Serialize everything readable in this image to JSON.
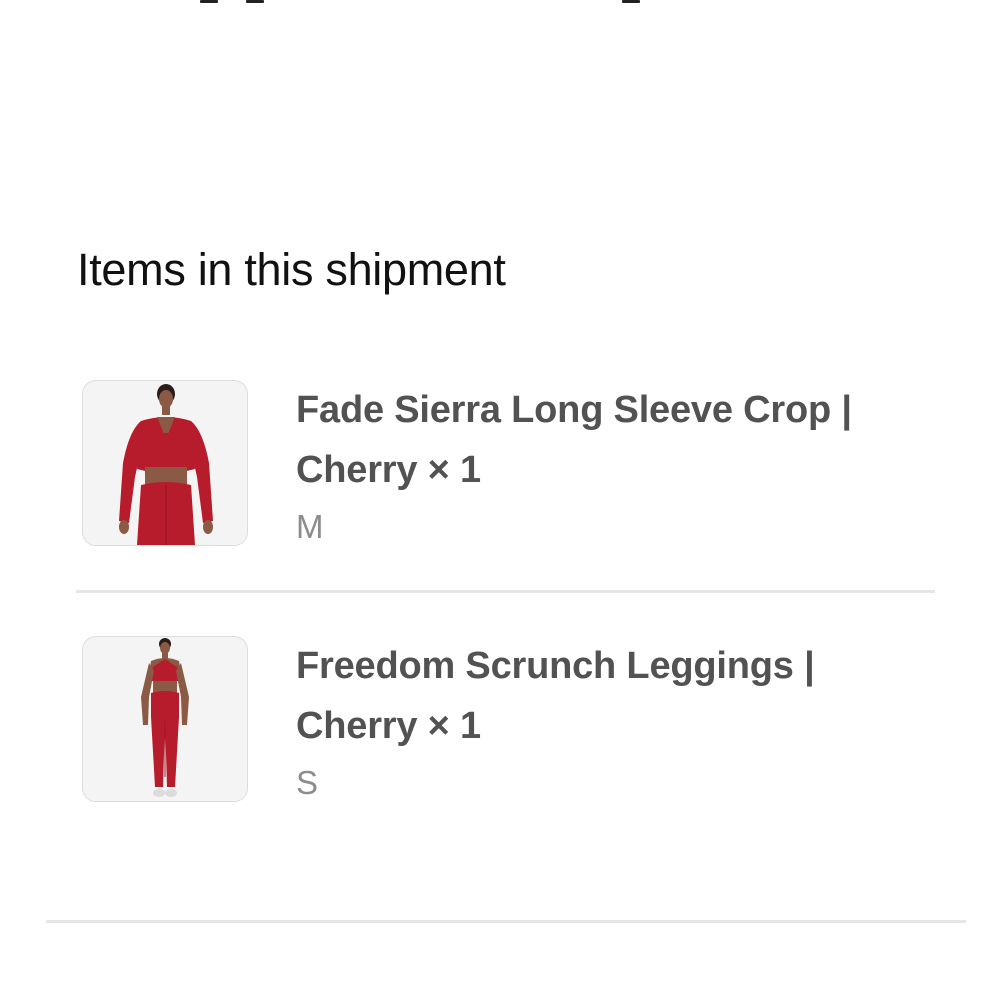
{
  "shipment": {
    "title": "Items in this shipment",
    "items": [
      {
        "name": "Fade Sierra Long Sleeve Crop | Cherry",
        "quantity": "× 1",
        "variant": "M",
        "image_icon": "product-photo-top",
        "color": "#b71c2c"
      },
      {
        "name": "Freedom Scrunch Leggings | Cherry",
        "quantity": "× 1",
        "variant": "S",
        "image_icon": "product-photo-leggings",
        "color": "#b71c2c"
      }
    ]
  },
  "colors": {
    "background": "#ffffff",
    "title": "#111111",
    "item_name": "#525252",
    "variant": "#8c8c8c",
    "divider": "#e6e6e6",
    "thumb_bg": "#f4f4f4",
    "product_cherry": "#b71c2c"
  }
}
